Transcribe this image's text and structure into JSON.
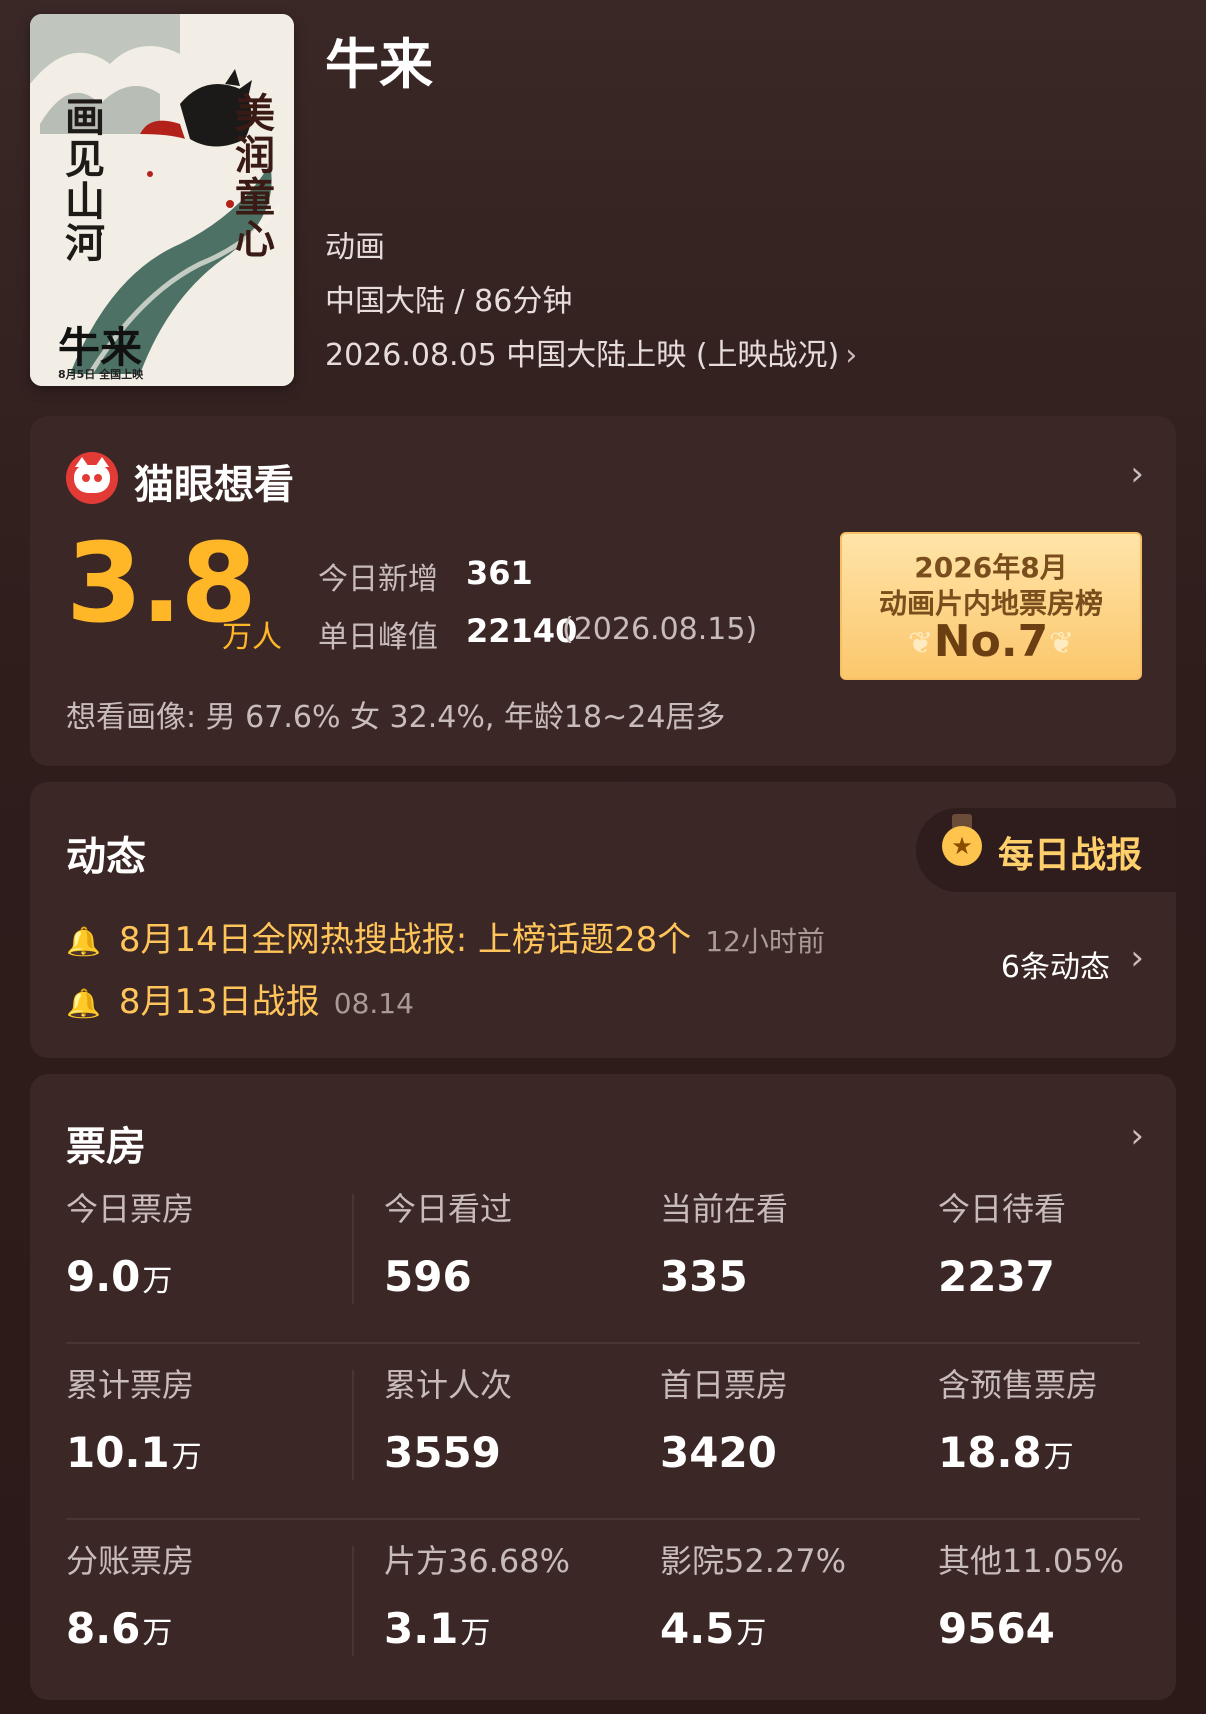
{
  "movie": {
    "title": "牛来",
    "genre": "动画",
    "region_duration": "中国大陆 / 86分钟",
    "release": "2026.08.05 中国大陆上映 (上映战况)",
    "poster_text": {
      "left": "画见山河",
      "right": "美润童心",
      "title": "牛来",
      "date": "8月5日 全国上映"
    }
  },
  "wish": {
    "title": "猫眼想看",
    "count": "3.8",
    "unit": "万人",
    "today_label": "今日新增",
    "today_value": "361",
    "peak_label": "单日峰值",
    "peak_value": "22140",
    "peak_date": "(2026.08.15)",
    "badge_line1": "2026年8月",
    "badge_line2": "动画片内地票房榜",
    "badge_rank": "No.7",
    "persona": "想看画像: 男 67.6%  女 32.4%, 年龄18~24居多"
  },
  "news": {
    "title": "动态",
    "report_button": "每日战报",
    "items": [
      {
        "text": "8月14日全网热搜战报: 上榜话题28个",
        "time": "12小时前"
      },
      {
        "text": "8月13日战报",
        "time": "08.14"
      }
    ],
    "more": "6条动态"
  },
  "boxoffice": {
    "title": "票房",
    "rows": [
      [
        {
          "label": "今日票房",
          "value": "9.0",
          "unit": "万"
        },
        {
          "label": "今日看过",
          "value": "596",
          "unit": ""
        },
        {
          "label": "当前在看",
          "value": "335",
          "unit": ""
        },
        {
          "label": "今日待看",
          "value": "2237",
          "unit": ""
        }
      ],
      [
        {
          "label": "累计票房",
          "value": "10.1",
          "unit": "万"
        },
        {
          "label": "累计人次",
          "value": "3559",
          "unit": ""
        },
        {
          "label": "首日票房",
          "value": "3420",
          "unit": ""
        },
        {
          "label": "含预售票房",
          "value": "18.8",
          "unit": "万"
        }
      ],
      [
        {
          "label": "分账票房",
          "value": "8.6",
          "unit": "万"
        },
        {
          "label": "片方36.68%",
          "value": "3.1",
          "unit": "万"
        },
        {
          "label": "影院52.27%",
          "value": "4.5",
          "unit": "万"
        },
        {
          "label": "其他11.05%",
          "value": "9564",
          "unit": ""
        }
      ]
    ]
  },
  "icons": {
    "chevron": "chevron-right-icon",
    "bell": "bell-icon",
    "medal": "medal-icon",
    "logo": "maoyan-cat-logo"
  },
  "colors": {
    "accent_gold": "#ffb627",
    "news_gold": "#ffc55a",
    "card_bg": "#3b2725",
    "page_bg": "#2e1c1b"
  }
}
